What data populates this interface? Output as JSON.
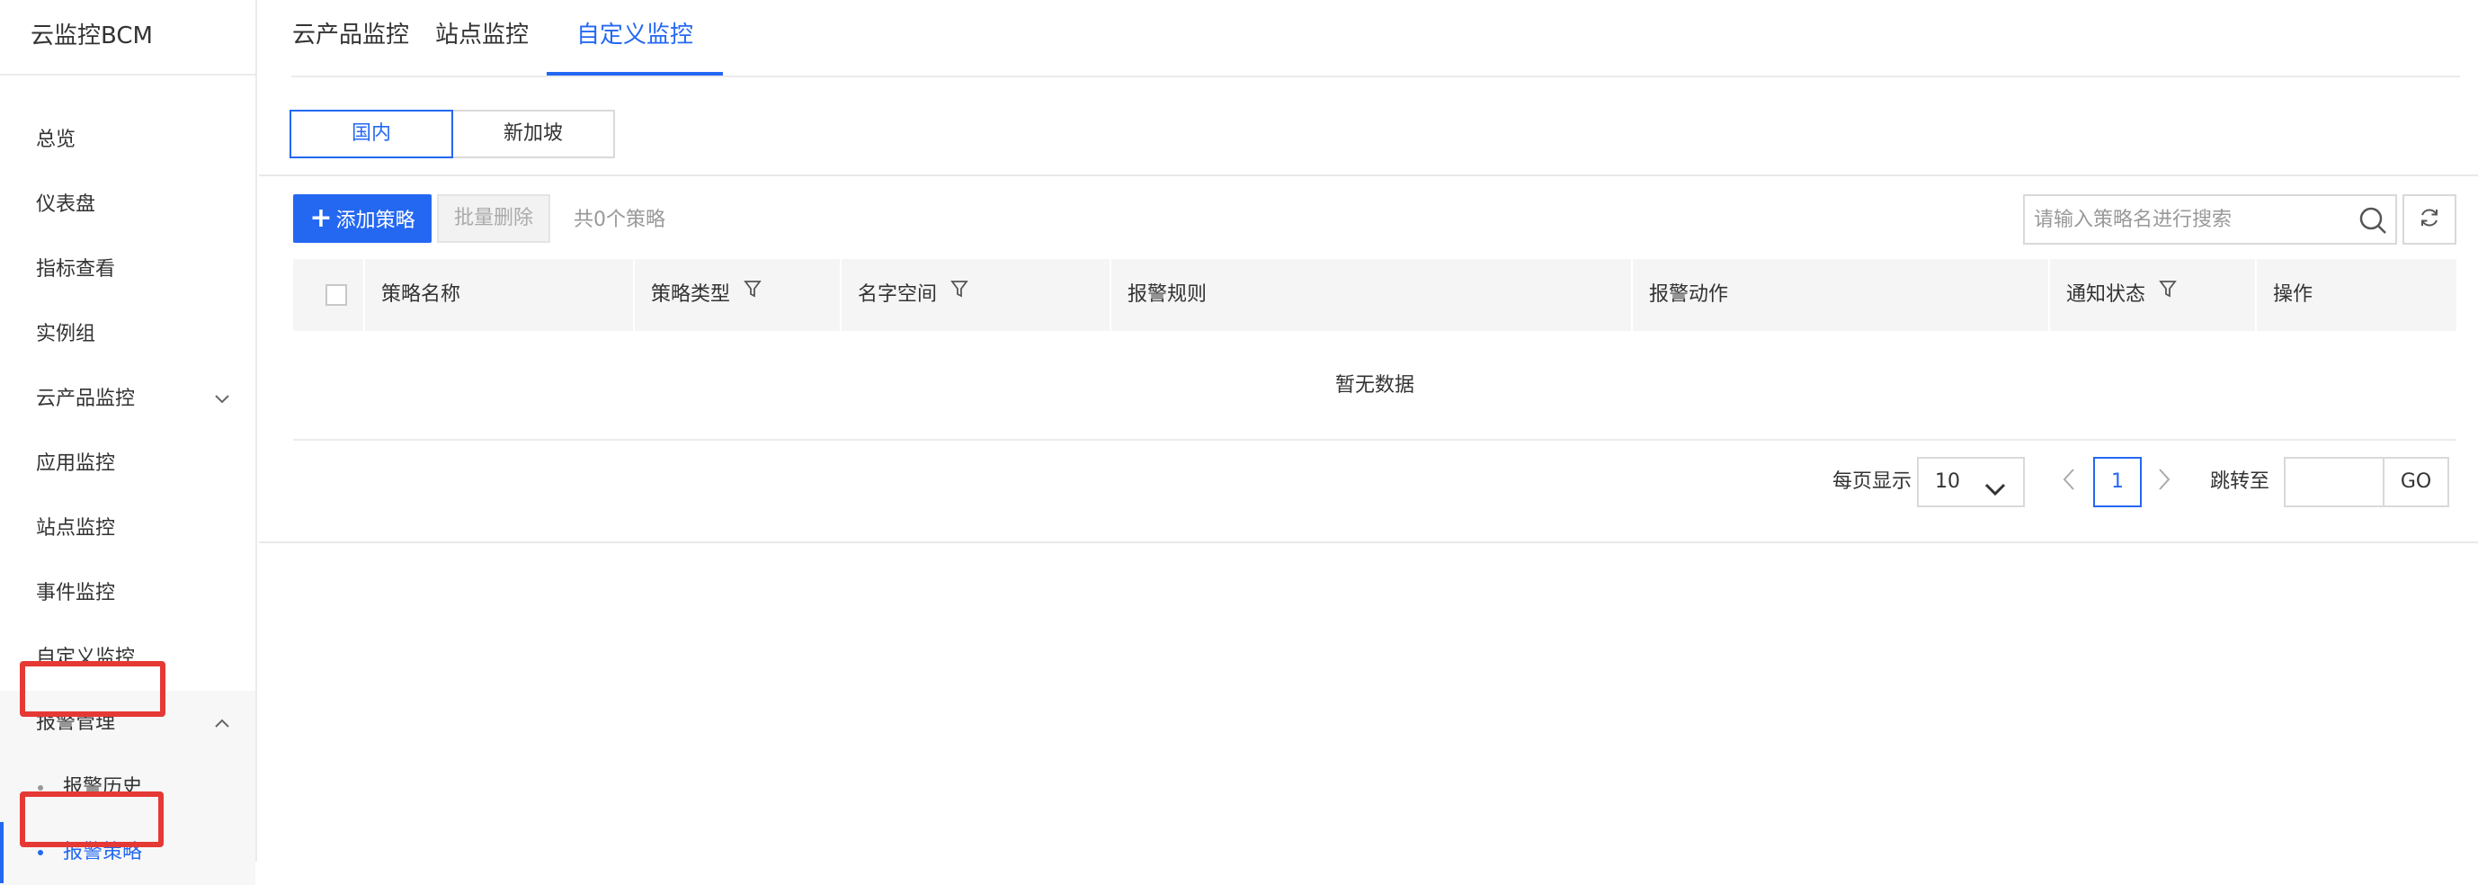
{
  "sidebar": {
    "title": "云监控BCM",
    "items": [
      {
        "label": "总览"
      },
      {
        "label": "仪表盘"
      },
      {
        "label": "指标查看"
      },
      {
        "label": "实例组"
      },
      {
        "label": "云产品监控"
      },
      {
        "label": "应用监控"
      },
      {
        "label": "站点监控"
      },
      {
        "label": "事件监控"
      },
      {
        "label": "自定义监控"
      }
    ],
    "group": {
      "label": "报警管理",
      "children": [
        {
          "label": "报警历史"
        },
        {
          "label": "报警策略"
        }
      ]
    }
  },
  "tabs": [
    {
      "label": "云产品监控"
    },
    {
      "label": "站点监控"
    },
    {
      "label": "自定义监控"
    }
  ],
  "region": {
    "options": [
      {
        "label": "国内"
      },
      {
        "label": "新加坡"
      }
    ],
    "selected": "国内"
  },
  "toolbar": {
    "add_label": "添加策略",
    "batch_delete_label": "批量删除",
    "count_text": "共0个策略"
  },
  "search": {
    "placeholder": "请输入策略名进行搜索"
  },
  "table": {
    "columns": [
      {
        "label": "策略名称"
      },
      {
        "label": "策略类型"
      },
      {
        "label": "名字空间"
      },
      {
        "label": "报警规则"
      },
      {
        "label": "报警动作"
      },
      {
        "label": "通知状态"
      },
      {
        "label": "操作"
      }
    ],
    "empty_text": "暂无数据",
    "rows": []
  },
  "pagination": {
    "per_page_label": "每页显示",
    "per_page_value": "10",
    "current_page": "1",
    "jump_label": "跳转至",
    "go_label": "GO"
  },
  "colors": {
    "accent": "#2468f2",
    "highlight": "#e53935"
  }
}
